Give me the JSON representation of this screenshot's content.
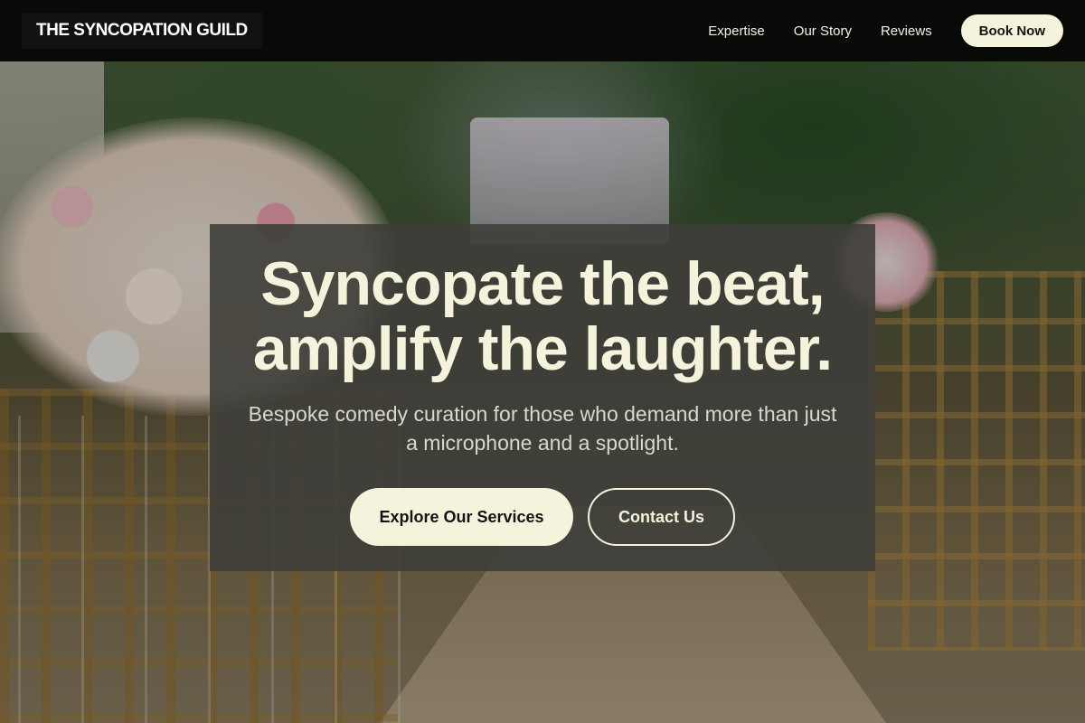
{
  "header": {
    "brand": "THE SYNCOPATION GUILD",
    "nav": [
      {
        "label": "Expertise"
      },
      {
        "label": "Our Story"
      },
      {
        "label": "Reviews"
      }
    ],
    "cta_label": "Book Now"
  },
  "hero": {
    "title_line1": "Syncopate the beat,",
    "title_line2": "amplify the laughter.",
    "subtitle": "Bespoke comedy curation for those who demand more than just a microphone and a spotlight.",
    "primary_button": "Explore Our Services",
    "secondary_button": "Contact Us"
  },
  "colors": {
    "accent": "#f6f3dc",
    "header_bg": "#050505",
    "hero_card_bg": "#3e3e3a"
  }
}
